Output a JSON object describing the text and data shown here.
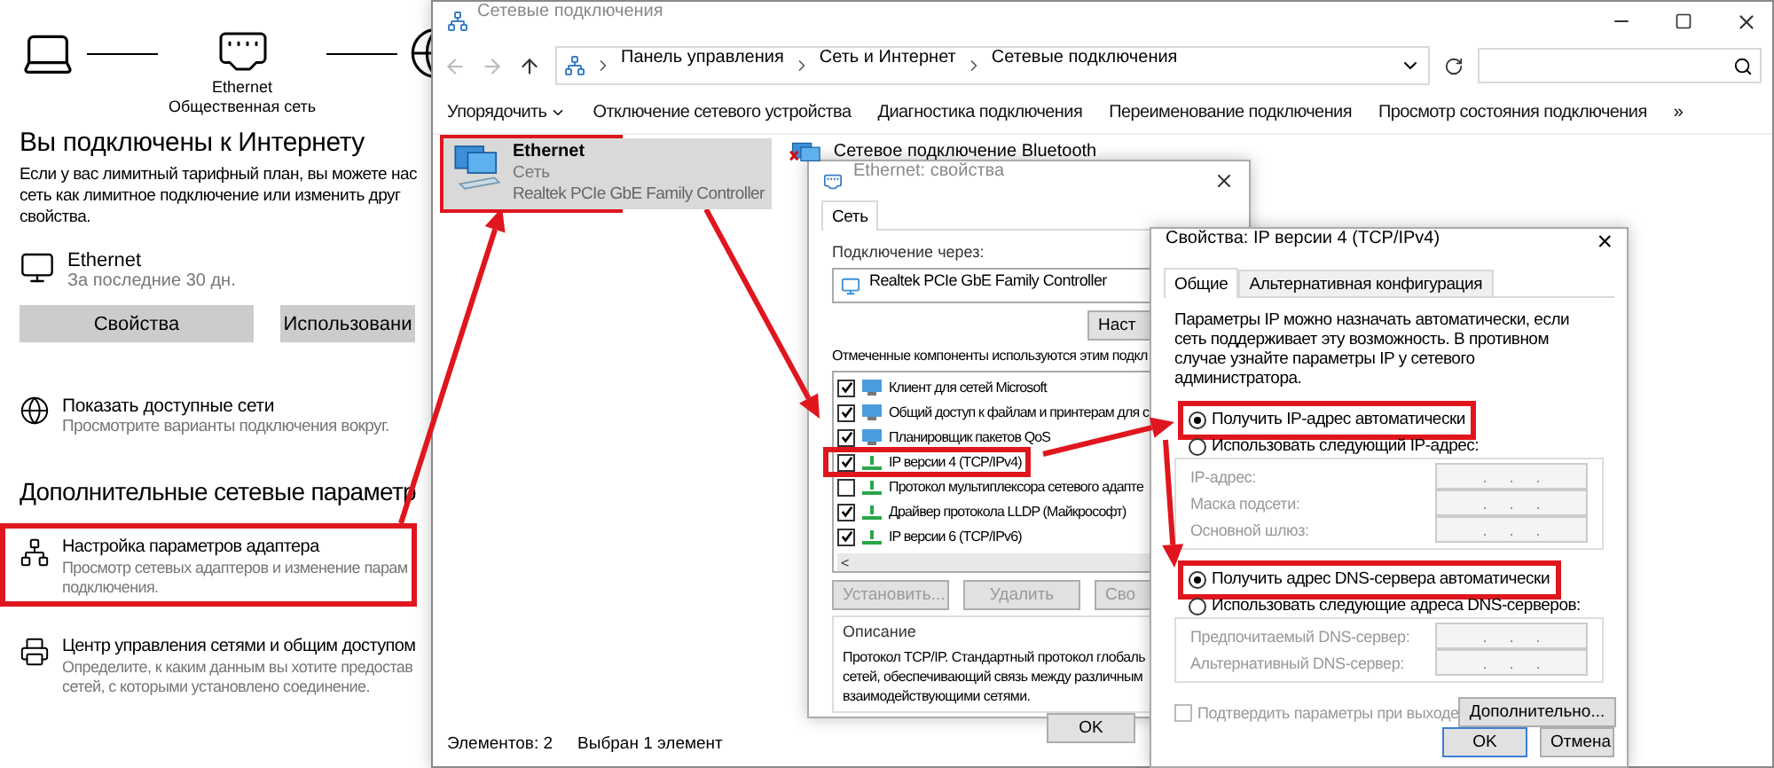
{
  "settings": {
    "diagram": {
      "adapter_name": "Ethernet",
      "network_type": "Общественная сеть"
    },
    "status_title": "Вы подключены к Интернету",
    "status_text": "Если у вас лимитный тарифный план, вы можете нас\nсеть как лимитное подключение или изменить друг\nсвойства.",
    "connection": {
      "name": "Ethernet",
      "usage": "За последние 30 дн."
    },
    "buttons": [
      {
        "label": "Свойства"
      },
      {
        "label": "Использовани"
      }
    ],
    "show_networks": {
      "title": "Показать доступные сети",
      "subtitle": "Просмотрите варианты подключения вокруг."
    },
    "section_title": "Дополнительные сетевые параметр",
    "links": [
      {
        "kind": "adapter",
        "title": "Настройка параметров адаптера",
        "subtitle": "Просмотр сетевых адаптеров и изменение парам\nподключения.",
        "highlighted": true
      },
      {
        "kind": "center",
        "title": "Центр управления сетями и общим доступом",
        "subtitle": "Определите, к каким данным вы хотите предостав\nсетей, с которыми установлено соединение.",
        "highlighted": false
      }
    ]
  },
  "explorer": {
    "title": "Сетевые подключения",
    "breadcrumbs": [
      "Панель управления",
      "Сеть и Интернет",
      "Сетевые подключения"
    ],
    "toolbar": [
      {
        "label": "Упорядочить",
        "kind": "menu"
      },
      {
        "label": "Отключение сетевого устройства",
        "kind": "command"
      },
      {
        "label": "Диагностика подключения",
        "kind": "command"
      },
      {
        "label": "Переименование подключения",
        "kind": "command"
      },
      {
        "label": "Просмотр состояния подключения",
        "kind": "command"
      },
      {
        "label": "»",
        "kind": "more"
      }
    ],
    "connections": [
      {
        "name": "Ethernet",
        "status": "Сеть",
        "device": "Realtek PCIe GbE Family Controller",
        "selected": true,
        "disabled": false,
        "highlighted": true
      },
      {
        "name": "Сетевое подключение Bluetooth",
        "selected": false,
        "disabled": true,
        "highlighted": false
      }
    ],
    "status_bar": {
      "count": "Элементов: 2",
      "selection": "Выбран 1 элемент"
    }
  },
  "ethernet_dialog": {
    "title": "Ethernet: свойства",
    "tabs": [
      {
        "label": "Сеть",
        "selected": true
      }
    ],
    "connect_using_label": "Подключение через:",
    "adapter": "Realtek PCIe GbE Family Controller",
    "configure_button": "Наст",
    "components_label": "Отмеченные компоненты используются этим подкл",
    "components": [
      {
        "name": "Клиент для сетей Microsoft",
        "checked": true,
        "kind": "client",
        "highlighted": false
      },
      {
        "name": "Общий доступ к файлам и принтерам для с",
        "checked": true,
        "kind": "client",
        "highlighted": false
      },
      {
        "name": "Планировщик пакетов QoS",
        "checked": true,
        "kind": "client",
        "highlighted": false
      },
      {
        "name": "IP версии 4 (TCP/IPv4)",
        "checked": true,
        "kind": "protocol",
        "highlighted": true
      },
      {
        "name": "Протокол мультиплексора сетевого адапте",
        "checked": false,
        "kind": "protocol",
        "highlighted": false
      },
      {
        "name": "Драйвер протокола LLDP (Майкрософт)",
        "checked": true,
        "kind": "protocol",
        "highlighted": false
      },
      {
        "name": "IP версии 6 (TCP/IPv6)",
        "checked": true,
        "kind": "protocol",
        "highlighted": false
      }
    ],
    "scroll_left": "<",
    "buttons": [
      {
        "label": "Установить...",
        "disabled": true
      },
      {
        "label": "Удалить",
        "disabled": true
      },
      {
        "label": "Сво",
        "disabled": true
      }
    ],
    "description_title": "Описание",
    "description": "Протокол TCP/IP. Стандартный протокол глобаль\nсетей, обеспечивающий связь между различным\nвзаимодействующими сетями.",
    "ok": "OK"
  },
  "ipv4_dialog": {
    "title": "Свойства: IP версии 4 (TCP/IPv4)",
    "close": "×",
    "tabs": [
      {
        "label": "Общие",
        "selected": true
      },
      {
        "label": "Альтернативная конфигурация",
        "selected": false
      }
    ],
    "intro": "Параметры IP можно назначать автоматически, если сеть поддерживает эту возможность. В противном случае узнайте параметры IP у сетевого администратора.",
    "ip_mode": [
      {
        "label": "Получить IP-адрес автоматически",
        "selected": true,
        "highlighted": true
      },
      {
        "label": "Использовать следующий IP-адрес:",
        "selected": false,
        "highlighted": false
      }
    ],
    "ip_fields": [
      {
        "label": "IP-адрес:",
        "value": ".     .     ."
      },
      {
        "label": "Маска подсети:",
        "value": ".     .     ."
      },
      {
        "label": "Основной шлюз:",
        "value": ".     .     ."
      }
    ],
    "dns_mode": [
      {
        "label": "Получить адрес DNS-сервера автоматически",
        "selected": true,
        "highlighted": true
      },
      {
        "label": "Использовать следующие адреса DNS-серверов:",
        "selected": false,
        "highlighted": false
      }
    ],
    "dns_fields": [
      {
        "label": "Предпочитаемый DNS-сервер:",
        "value": ".     .     ."
      },
      {
        "label": "Альтернативный DNS-сервер:",
        "value": ".     .     ."
      }
    ],
    "validate": {
      "label": "Подтвердить параметры при выходе",
      "checked": false,
      "disabled": true
    },
    "advanced_button": "Дополнительно...",
    "ok": "OK",
    "cancel": "Отмена"
  }
}
